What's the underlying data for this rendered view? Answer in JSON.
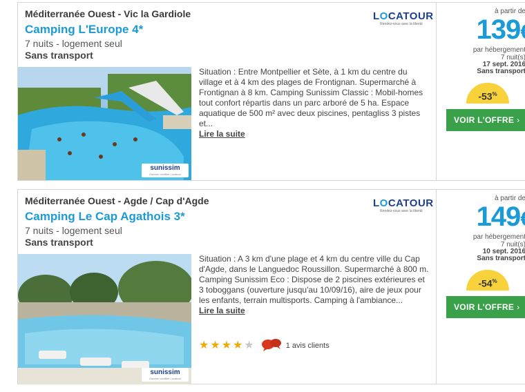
{
  "offers": [
    {
      "region": "Méditerranée Ouest - Vic la Gardiole",
      "name": "Camping L'Europe 4*",
      "duration": "7 nuits - logement seul",
      "transport": "Sans transport",
      "logo": {
        "word_pre": "L",
        "word_accent": "O",
        "word_post": "CATOUR",
        "tagline": "Rendez-vous avec la liberté"
      },
      "photo_badge": {
        "brand": "sunissim",
        "sub": "Gamme certifiée Locatour"
      },
      "description": "Situation : Entre Montpellier et Sète, à 1 km du centre du village et à 4 km des plages de Frontignan. Supermarché à Frontignan à 8 km. Camping Sunissim Classic : Mobil-homes tout confort répartis dans un parc arboré de 5 ha. Espace aquatique de 500 m² avec deux piscines, pentagliss 3 pistes et...",
      "read_more": "Lire la suite",
      "price": {
        "from": "à partir de",
        "amount": "139",
        "currency": "€",
        "per": "par hébergement",
        "nights": "7 nuit(s)",
        "date": "17 sept. 2016",
        "transport": "Sans transport",
        "discount": "-53",
        "discount_unit": "%"
      },
      "cta": "VOIR L'OFFRE",
      "cta_icon": "chevron-right-icon"
    },
    {
      "region": "Méditerranée Ouest - Agde / Cap d'Agde",
      "name": "Camping Le Cap Agathois 3*",
      "duration": "7 nuits - logement seul",
      "transport": "Sans transport",
      "logo": {
        "word_pre": "L",
        "word_accent": "O",
        "word_post": "CATOUR",
        "tagline": "Rendez-vous avec la liberté"
      },
      "photo_badge": {
        "brand": "sunissim",
        "sub": "Gamme certifiée Locatour"
      },
      "description": "Situation : A 3 km d'une plage et 4 km du centre ville du Cap d'Agde, dans le Languedoc Roussillon. Supermarché à 800 m. Camping Sunissim Eco : Dispose de 2 piscines extérieures et 3 toboggans (ouverture jusqu'au 10/09/16), aire de jeux pour les enfants, terrain multisports. Camping à l'ambiance...",
      "read_more": "Lire la suite",
      "rating": {
        "stars": 4,
        "max": 5,
        "reviews": "1 avis clients"
      },
      "price": {
        "from": "à partir de",
        "amount": "149",
        "currency": "€",
        "per": "par hébergement",
        "nights": "7 nuit(s)",
        "date": "10 sept. 2016",
        "transport": "Sans transport",
        "discount": "-54",
        "discount_unit": "%"
      },
      "cta": "VOIR L'OFFRE",
      "cta_icon": "chevron-right-icon"
    }
  ],
  "colors": {
    "brand_blue": "#1a9ad6",
    "logo_navy": "#1c3f8c",
    "cta_green": "#3aa14a",
    "discount_yellow": "#f7d23b",
    "star_gold": "#f1a90a",
    "bubble_red": "#d9381e"
  }
}
